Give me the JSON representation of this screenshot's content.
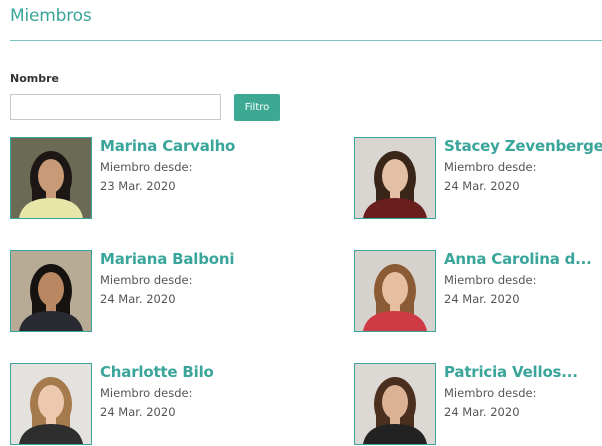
{
  "page": {
    "title": "Miembros"
  },
  "filter": {
    "label": "Nombre",
    "input_value": "",
    "button_label": "Filtro"
  },
  "members": [
    {
      "name": "Marina Carvalho",
      "since_label": "Miembro desde:",
      "date": "23 Mar. 2020",
      "bg": "#6b6a55",
      "hair": "#1c1714",
      "skin": "#c89a78",
      "shirt": "#e6e6a8"
    },
    {
      "name": "Stacey Zevenbergen",
      "since_label": "Miembro desde:",
      "date": "24 Mar. 2020",
      "bg": "#d9d6d2",
      "hair": "#3a2519",
      "skin": "#e3bfa6",
      "shirt": "#6a1f1f"
    },
    {
      "name": "Mariana Balboni",
      "since_label": "Miembro desde:",
      "date": "24 Mar. 2020",
      "bg": "#b8ab96",
      "hair": "#15120f",
      "skin": "#b98762",
      "shirt": "#2a2a33"
    },
    {
      "name": "Anna Carolina d...",
      "since_label": "Miembro desde:",
      "date": "24 Mar. 2020",
      "bg": "#d6d3cf",
      "hair": "#8a5b34",
      "skin": "#e6bfa0",
      "shirt": "#cf3b45"
    },
    {
      "name": "Charlotte Bilo",
      "since_label": "Miembro desde:",
      "date": "24 Mar. 2020",
      "bg": "#e4e2df",
      "hair": "#a57a4c",
      "skin": "#ecc8ae",
      "shirt": "#2e2e2e"
    },
    {
      "name": "Patricia Vellos...",
      "since_label": "Miembro desde:",
      "date": "24 Mar. 2020",
      "bg": "#dcd9d5",
      "hair": "#4a2e1e",
      "skin": "#dcb295",
      "shirt": "#222222"
    }
  ]
}
